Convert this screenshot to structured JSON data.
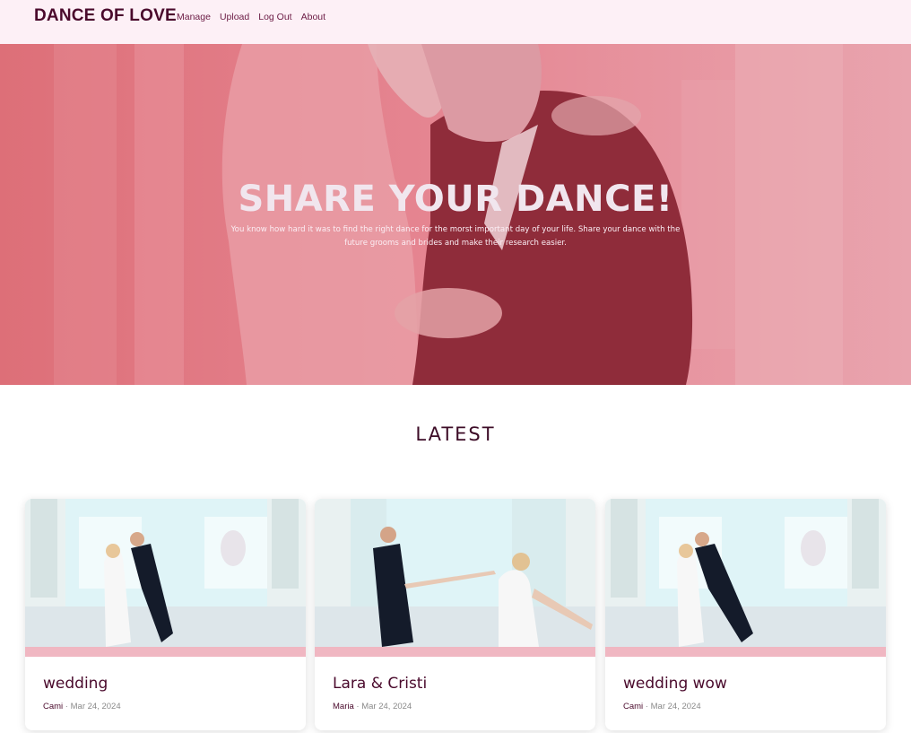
{
  "nav": {
    "brand": "DANCE OF LOVE",
    "links": [
      "Manage",
      "Upload",
      "Log Out",
      "About"
    ]
  },
  "hero": {
    "title": "SHARE YOUR DANCE!",
    "subtitle": "You know how hard it was to find the right dance for the morst important day of your life. Share your dance with the future grooms and brides and make their research easier."
  },
  "section": {
    "title": "LATEST"
  },
  "cards": [
    {
      "title": "wedding",
      "author": "Cami",
      "date": "Mar 24, 2024"
    },
    {
      "title": "Lara & Cristi",
      "author": "Maria",
      "date": "Mar 24, 2024"
    },
    {
      "title": "wedding wow",
      "author": "Cami",
      "date": "Mar 24, 2024"
    }
  ],
  "meta_separator": " · ",
  "colors": {
    "nav_bg": "#fdf0f6",
    "brand": "#4a0a2c",
    "hero_overlay": "#e07080",
    "accent": "#f0b7c2"
  }
}
